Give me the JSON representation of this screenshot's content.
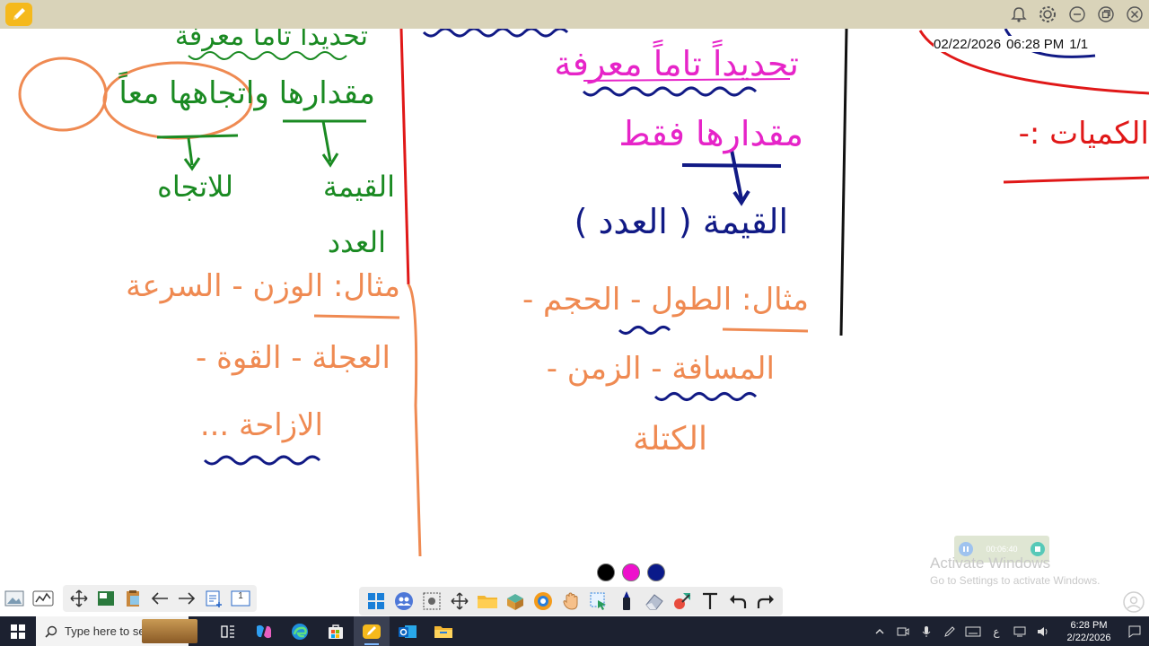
{
  "board_stamp": {
    "date": "02/22/2026",
    "time": "06:28 PM",
    "page": "1/1"
  },
  "recorder": {
    "elapsed": "00:06:40"
  },
  "watermark": {
    "line1": "Activate Windows",
    "line2": "Go to Settings to activate Windows."
  },
  "ink": {
    "green": [
      "تحديداً تاماً معرفة",
      "مقدارها واتجاهها معاً",
      "للاتجاه",
      "القيمة",
      "العدد"
    ],
    "pink": [
      "تحديداً تاماً معرفة",
      "مقدارها فقط"
    ],
    "navy": [
      "القيمة ( العدد )"
    ],
    "orange": [
      "مثال: الوزن - السرعة",
      "العجلة - القوة -",
      "الازاحة ...",
      "مثال: الطول - الحجم -",
      "المسافة - الزمن -",
      "الكتلة"
    ],
    "red": [
      "الكميات :-"
    ]
  },
  "swatches": [
    "#000000",
    "#ee11cc",
    "#0a1a8a"
  ],
  "left_tools": {
    "page_counter": "1"
  },
  "taskbar": {
    "search_placeholder": "Type here to search",
    "tray_lang": "ع",
    "clock_time": "6:28 PM",
    "clock_date": "2/22/2026"
  },
  "colors": {
    "titlebar": "#d9d3b9",
    "taskbar": "#1c2130",
    "accent": "#f5b91c"
  }
}
